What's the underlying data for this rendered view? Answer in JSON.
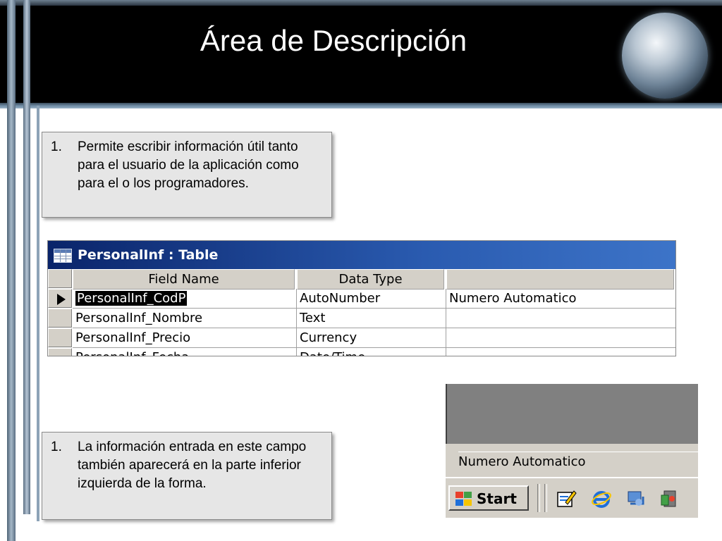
{
  "slide": {
    "title": "Área de Descripción"
  },
  "notes": [
    {
      "number": "1.",
      "text": "Permite escribir información útil tanto para el usuario de la aplicación como para el o los programadores."
    },
    {
      "number": "1.",
      "text": "La información entrada en este campo también aparecerá en la parte inferior izquierda de la forma."
    }
  ],
  "table_window": {
    "title": "PersonalInf : Table",
    "columns": [
      "Field Name",
      "Data Type",
      ""
    ],
    "rows": [
      {
        "field": "PersonalInf_CodP",
        "type": "AutoNumber",
        "description": "Numero Automatico",
        "selected": true
      },
      {
        "field": "PersonalInf_Nombre",
        "type": "Text",
        "description": ""
      },
      {
        "field": "PersonalInf_Precio",
        "type": "Currency",
        "description": ""
      },
      {
        "field": "PersonalInf_Fecha",
        "type": "Date/Time",
        "description": ""
      }
    ]
  },
  "taskbar": {
    "status_text": "Numero Automatico",
    "start_label": "Start",
    "quick_launch": [
      "edit-icon",
      "internet-explorer-icon",
      "network-icon",
      "media-icon"
    ]
  },
  "colors": {
    "header_bg": "#000000",
    "title_text": "#ffffff",
    "note_bg": "#e6e6e6",
    "titlebar_start": "#0a246a",
    "titlebar_end": "#3d74c8",
    "win_gray": "#d4d0c8"
  }
}
